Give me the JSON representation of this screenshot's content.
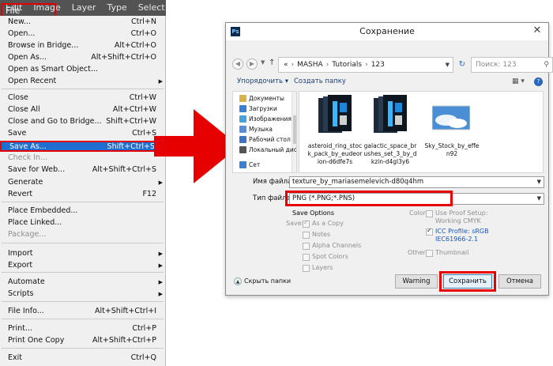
{
  "colors": {
    "highlight_red": "#e60000",
    "menu_selection": "#1f6fd1",
    "menubar_bg": "#535353",
    "dialog_bg": "#f0f0f0"
  },
  "menubar": [
    "File",
    "Edit",
    "Image",
    "Layer",
    "Type",
    "Select"
  ],
  "file_menu": {
    "items": [
      {
        "label": "New...",
        "shortcut": "Ctrl+N"
      },
      {
        "label": "Open...",
        "shortcut": "Ctrl+O"
      },
      {
        "label": "Browse in Bridge...",
        "shortcut": "Alt+Ctrl+O"
      },
      {
        "label": "Open As...",
        "shortcut": "Alt+Shift+Ctrl+O"
      },
      {
        "label": "Open as Smart Object...",
        "shortcut": ""
      },
      {
        "label": "Open Recent",
        "shortcut": "",
        "submenu": true
      },
      {
        "label": "Close",
        "shortcut": "Ctrl+W"
      },
      {
        "label": "Close All",
        "shortcut": "Alt+Ctrl+W"
      },
      {
        "label": "Close and Go to Bridge...",
        "shortcut": "Shift+Ctrl+W"
      },
      {
        "label": "Save",
        "shortcut": "Ctrl+S"
      },
      {
        "label": "Save As...",
        "shortcut": "Shift+Ctrl+S",
        "highlighted": true
      },
      {
        "label": "Check In...",
        "shortcut": "",
        "disabled": true
      },
      {
        "label": "Save for Web...",
        "shortcut": "Alt+Shift+Ctrl+S"
      },
      {
        "label": "Generate",
        "shortcut": "",
        "submenu": true
      },
      {
        "label": "Revert",
        "shortcut": "F12"
      },
      {
        "label": "Place Embedded...",
        "shortcut": ""
      },
      {
        "label": "Place Linked...",
        "shortcut": ""
      },
      {
        "label": "Package...",
        "shortcut": "",
        "disabled": true
      },
      {
        "label": "Import",
        "shortcut": "",
        "submenu": true
      },
      {
        "label": "Export",
        "shortcut": "",
        "submenu": true
      },
      {
        "label": "Automate",
        "shortcut": "",
        "submenu": true
      },
      {
        "label": "Scripts",
        "shortcut": "",
        "submenu": true
      },
      {
        "label": "File Info...",
        "shortcut": "Alt+Shift+Ctrl+I"
      },
      {
        "label": "Print...",
        "shortcut": "Ctrl+P"
      },
      {
        "label": "Print One Copy",
        "shortcut": "Alt+Shift+Ctrl+P"
      },
      {
        "label": "Exit",
        "shortcut": "Ctrl+Q"
      }
    ]
  },
  "dialog": {
    "title": "Сохранение",
    "app_icon": "Ps",
    "close_glyph": "✕",
    "address": {
      "root": "«",
      "parts": [
        "MASHA",
        "Tutorials",
        "123"
      ]
    },
    "search_placeholder": "Поиск: 123",
    "toolbar": {
      "organize": "Упорядочить ▾",
      "new_folder": "Создать папку"
    },
    "tree": [
      {
        "label": "Документы",
        "icon": "documents-icon",
        "color": "#d9b24a"
      },
      {
        "label": "Загрузки",
        "icon": "downloads-icon",
        "color": "#3a7fd0"
      },
      {
        "label": "Изображения",
        "icon": "pictures-icon",
        "color": "#4aa0d8"
      },
      {
        "label": "Музыка",
        "icon": "music-icon",
        "color": "#5b8ed6"
      },
      {
        "label": "Рабочий стол",
        "icon": "desktop-icon",
        "color": "#3f74c2"
      },
      {
        "label": "Локальный диск",
        "icon": "local-disk-icon",
        "color": "#555555"
      },
      {
        "label": "Сет",
        "icon": "network-icon",
        "color": "#3a7fd0"
      }
    ],
    "files": [
      {
        "name": "asteroid_ring_stock_pack_by_eudeorion-d6dfe7s",
        "icon": "abr-file-icon"
      },
      {
        "name": "galactic_space_brushes_set_3_by_dkzin-d4gl3y6",
        "icon": "abr-file-icon"
      },
      {
        "name": "Sky_Stock_by_effen92",
        "icon": "image-file-icon"
      }
    ],
    "filename_label": "Имя файла:",
    "filename_value": "texture_by_mariasemelevich-d80q4hm",
    "filetype_label": "Тип файла:",
    "filetype_value": "PNG (*.PNG;*.PNS)",
    "save_options": {
      "heading": "Save Options",
      "save_label": "Save:",
      "as_copy": "As a Copy",
      "notes": "Notes",
      "alpha": "Alpha Channels",
      "spot": "Spot Colors",
      "layers": "Layers",
      "color_label": "Color:",
      "proof_line1": "Use Proof Setup:",
      "proof_line2": "Working CMYK",
      "icc_line1": "ICC Profile:  sRGB",
      "icc_line2": "IEC61966-2.1",
      "other_label": "Other:",
      "thumbnail": "Thumbnail"
    },
    "hide_folders": "Скрыть папки",
    "buttons": {
      "warning": "Warning",
      "save": "Сохранить",
      "cancel": "Отмена"
    }
  }
}
